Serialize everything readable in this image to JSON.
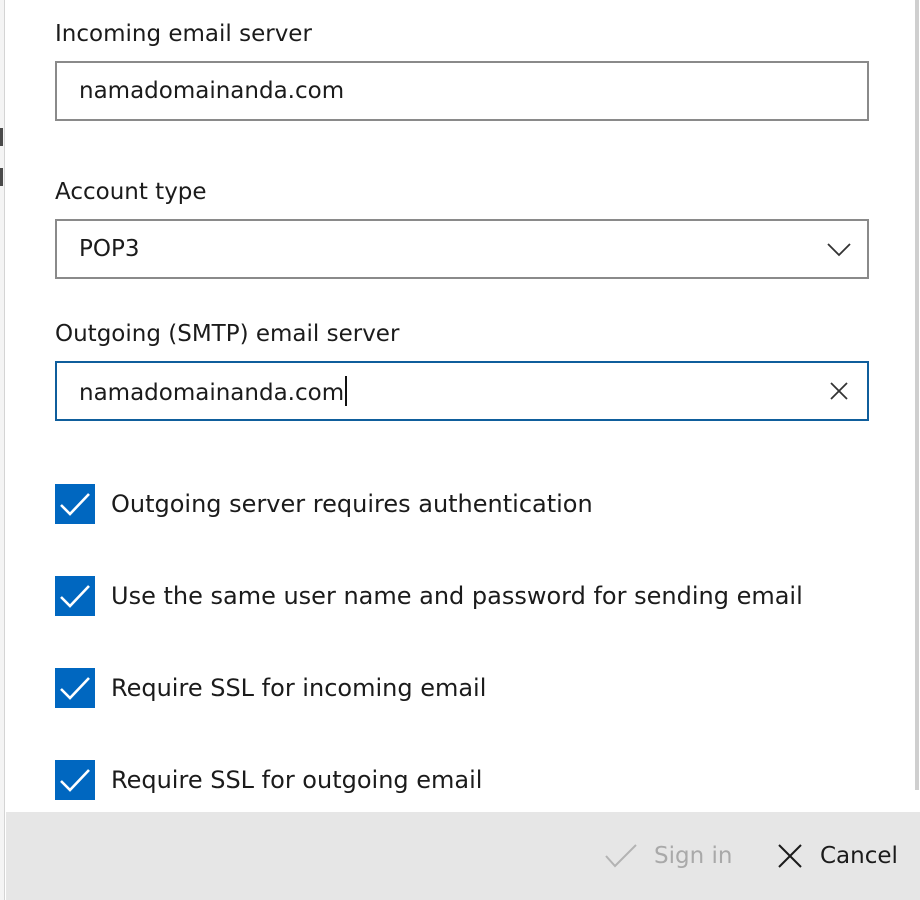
{
  "incoming_server": {
    "label": "Incoming email server",
    "value": "namadomainanda.com"
  },
  "account_type": {
    "label": "Account type",
    "selected": "POP3",
    "icon": "chevron-down-icon"
  },
  "outgoing_server": {
    "label": "Outgoing (SMTP) email server",
    "value": "namadomainanda.com",
    "clear_icon": "close-icon"
  },
  "options": [
    {
      "label": "Outgoing server requires authentication",
      "checked": true
    },
    {
      "label": "Use the same user name and password for sending email",
      "checked": true
    },
    {
      "label": "Require SSL for incoming email",
      "checked": true
    },
    {
      "label": "Require SSL for outgoing email",
      "checked": true
    }
  ],
  "footer": {
    "sign_in_label": "Sign in",
    "sign_in_icon": "checkmark-icon",
    "cancel_label": "Cancel",
    "cancel_icon": "close-icon"
  },
  "colors": {
    "accent": "#0067c0",
    "focus_border": "#0f5e9c",
    "disabled_text": "#a9a9a9",
    "footer_bg": "#e6e6e6"
  }
}
